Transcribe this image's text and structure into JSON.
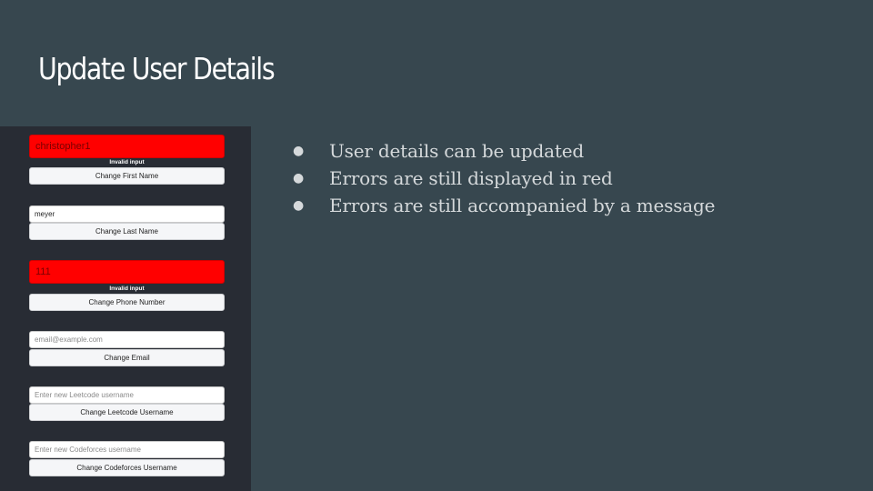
{
  "slide": {
    "title": "Update User Details"
  },
  "form": {
    "first_name": {
      "value": "christopher1",
      "placeholder": "",
      "error": "Invalid input",
      "button_label": "Change First Name"
    },
    "last_name": {
      "value": "meyer",
      "placeholder": "",
      "button_label": "Change Last Name"
    },
    "phone_number": {
      "value": "111",
      "placeholder": "",
      "error": "Invalid input",
      "button_label": "Change Phone Number"
    },
    "email": {
      "value": "",
      "placeholder": "email@example.com",
      "button_label": "Change Email"
    },
    "leetcode_username": {
      "value": "",
      "placeholder": "Enter new Leetcode username",
      "button_label": "Change Leetcode Username"
    },
    "codeforces_username": {
      "value": "",
      "placeholder": "Enter new Codeforces username",
      "button_label": "Change Codeforces Username"
    }
  },
  "colors": {
    "slide_background": "#37474f",
    "panel_background": "#282c34",
    "error_field": "#ff0000"
  },
  "bullets": [
    "User details can be updated",
    "Errors are still displayed in red",
    "Errors are still accompanied by a message"
  ],
  "bullet_marker": "●"
}
